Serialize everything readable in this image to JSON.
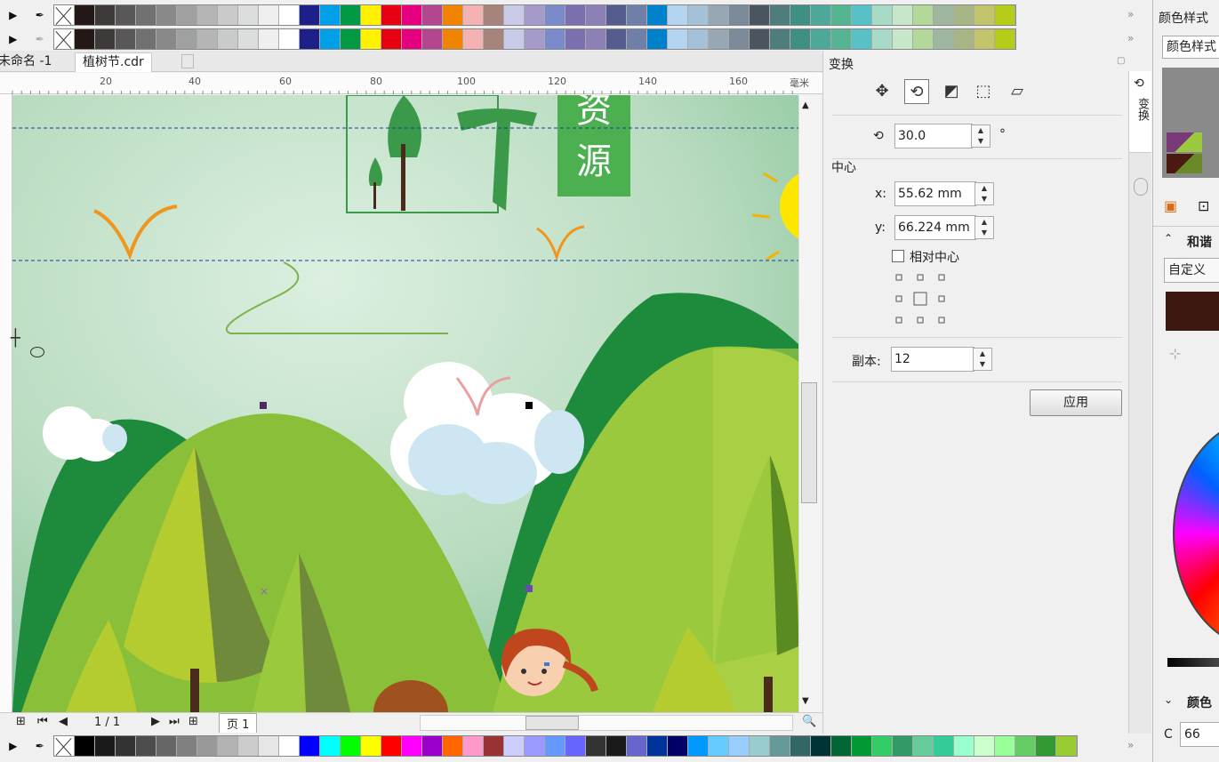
{
  "palettes": {
    "top1": [
      "#nocolor",
      "#231815",
      "#3e3a39",
      "#595757",
      "#727171",
      "#898989",
      "#9fa0a0",
      "#b5b5b6",
      "#c9caca",
      "#dcdddd",
      "#efefef",
      "#ffffff",
      "#1d2088",
      "#00a0e9",
      "#009944",
      "#fff100",
      "#e60012",
      "#e4007f",
      "#b4458f",
      "#f08300",
      "#f5b2b2",
      "#a6847b",
      "#c9c9e8",
      "#a59aca",
      "#7a8acb",
      "#7b6fb0",
      "#8c80b6",
      "#535c8d",
      "#6f7fa8",
      "#0081cc",
      "#b3d4f0",
      "#a4c1d8",
      "#98a7b4",
      "#7a8a99",
      "#4b5560",
      "#4f7c7c",
      "#3f8f84",
      "#4da89a",
      "#55b592",
      "#57c1c7",
      "#a7dbc8",
      "#c8e6c9",
      "#b4d89a",
      "#9fb7a0",
      "#a8b585",
      "#c1c46b",
      "#b5cc18"
    ],
    "top2": [
      "#nocolor",
      "#231815",
      "#3e3a39",
      "#595757",
      "#727171",
      "#898989",
      "#9fa0a0",
      "#b5b5b6",
      "#c9caca",
      "#dcdddd",
      "#efefef",
      "#ffffff",
      "#1d2088",
      "#00a0e9",
      "#009944",
      "#fff100",
      "#e60012",
      "#e4007f",
      "#b4458f",
      "#f08300",
      "#f5b2b2",
      "#a6847b",
      "#c9c9e8",
      "#a59aca",
      "#7a8acb",
      "#7b6fb0",
      "#8c80b6",
      "#535c8d",
      "#6f7fa8",
      "#0081cc",
      "#b3d4f0",
      "#a4c1d8",
      "#98a7b4",
      "#7a8a99",
      "#4b5560",
      "#4f7c7c",
      "#3f8f84",
      "#4da89a",
      "#55b592",
      "#57c1c7",
      "#a7dbc8",
      "#c8e6c9",
      "#b4d89a",
      "#9fb7a0",
      "#a8b585",
      "#c1c46b",
      "#b5cc18"
    ],
    "bottom": [
      "#nocolor",
      "#000000",
      "#1a1a1a",
      "#333333",
      "#4d4d4d",
      "#666666",
      "#808080",
      "#999999",
      "#b3b3b3",
      "#cccccc",
      "#e6e6e6",
      "#ffffff",
      "#0000ff",
      "#00ffff",
      "#00ff00",
      "#ffff00",
      "#ff0000",
      "#ff00ff",
      "#9900cc",
      "#ff6600",
      "#ff99cc",
      "#993333",
      "#ccccff",
      "#9999ff",
      "#6699ff",
      "#6666ff",
      "#333333",
      "#1a1a1a",
      "#6666cc",
      "#003399",
      "#000066",
      "#0099ff",
      "#66ccff",
      "#99ccff",
      "#99cccc",
      "#669999",
      "#336666",
      "#003333",
      "#006633",
      "#009933",
      "#33cc66",
      "#339966",
      "#66cc99",
      "#33cc99",
      "#99ffcc",
      "#ccffcc",
      "#99ff99",
      "#66cc66",
      "#339933",
      "#99cc33"
    ],
    "more": "»"
  },
  "tabs": {
    "untitled": "未命名 -1",
    "file": "植树节.cdr"
  },
  "ruler": {
    "labels": [
      "20",
      "40",
      "60",
      "80",
      "100",
      "120",
      "140",
      "160"
    ],
    "unit": "毫米"
  },
  "canvas": {
    "title_chars": [
      "资",
      "源"
    ]
  },
  "pager": {
    "page_count": "1 / 1",
    "page_tab": "页 1"
  },
  "docker": {
    "title": "变换",
    "rotation_value": "30.0",
    "degree_symbol": "°",
    "center_label": "中心",
    "x_label": "x:",
    "x_value": "55.62 mm",
    "y_label": "y:",
    "y_value": "66.224 mm",
    "relative_center_label": "相对中心",
    "copies_label": "副本:",
    "copies_value": "12",
    "apply_label": "应用",
    "side_tab_label": "变换"
  },
  "right_panel": {
    "title": "颜色样式",
    "dropdown": "颜色样式",
    "harmony_label": "和谐",
    "custom_label": "自定义",
    "color_section": "颜色",
    "c_label": "C",
    "c_value": "66",
    "swatch_color": "#3d1810"
  }
}
